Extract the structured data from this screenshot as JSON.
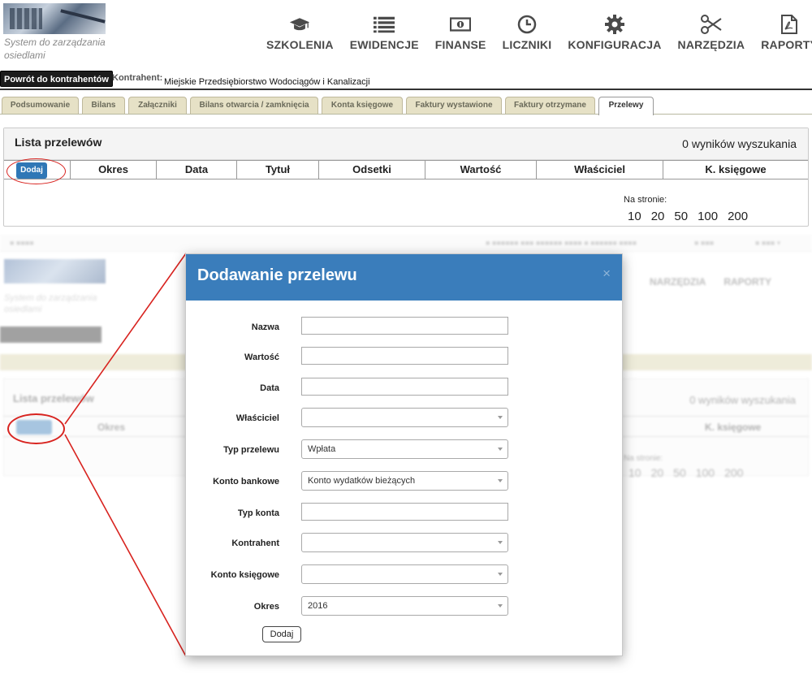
{
  "app": {
    "logo_text": "System do zarządzania osiedlami",
    "nav": [
      {
        "label": "SZKOLENIA",
        "icon": "graduation-cap-icon"
      },
      {
        "label": "EWIDENCJE",
        "icon": "list-icon"
      },
      {
        "label": "FINANSE",
        "icon": "money-icon"
      },
      {
        "label": "LICZNIKI",
        "icon": "clock-icon"
      },
      {
        "label": "KONFIGURACJA",
        "icon": "gear-icon"
      },
      {
        "label": "NARZĘDZIA",
        "icon": "scissors-icon"
      },
      {
        "label": "RAPORTY",
        "icon": "pdf-file-icon"
      }
    ]
  },
  "header": {
    "back_button": "Powrót do kontrahentów",
    "contractor_label": "Kontrahent:",
    "contractor_value": "Miejskie Przedsiębiorstwo Wodociągów i Kanalizacji"
  },
  "tabs": [
    "Podsumowanie",
    "Bilans",
    "Załączniki",
    "Bilans otwarcia / zamknięcia",
    "Konta księgowe",
    "Faktury wystawione",
    "Faktury otrzymane",
    "Przelewy"
  ],
  "active_tab": "Przelewy",
  "list": {
    "title": "Lista przelewów",
    "results": "0 wyników wyszukania",
    "add_button": "Dodaj",
    "columns": [
      "Okres",
      "Data",
      "Tytuł",
      "Odsetki",
      "Wartość",
      "Właściciel",
      "K. księgowe"
    ],
    "per_page_label": "Na stronie:",
    "per_page_options": [
      "10",
      "20",
      "50",
      "100",
      "200"
    ]
  },
  "modal": {
    "title": "Dodawanie przelewu",
    "close_symbol": "×",
    "fields": [
      {
        "label": "Nazwa",
        "type": "input",
        "value": ""
      },
      {
        "label": "Wartość",
        "type": "input",
        "value": ""
      },
      {
        "label": "Data",
        "type": "input",
        "value": ""
      },
      {
        "label": "Właściciel",
        "type": "select",
        "value": ""
      },
      {
        "label": "Typ przelewu",
        "type": "select",
        "value": "Wpłata"
      },
      {
        "label": "Konto bankowe",
        "type": "select",
        "value": "Konto wydatków bieżących"
      },
      {
        "label": "Typ konta",
        "type": "input",
        "value": ""
      },
      {
        "label": "Kontrahent",
        "type": "select",
        "value": ""
      },
      {
        "label": "Konto księgowe",
        "type": "select",
        "value": ""
      },
      {
        "label": "Okres",
        "type": "select",
        "value": "2016"
      }
    ],
    "submit": "Dodaj"
  },
  "colors": {
    "accent": "#3a7dbb",
    "highlight": "#d8231f",
    "tab_bg": "#e6e1c6"
  }
}
